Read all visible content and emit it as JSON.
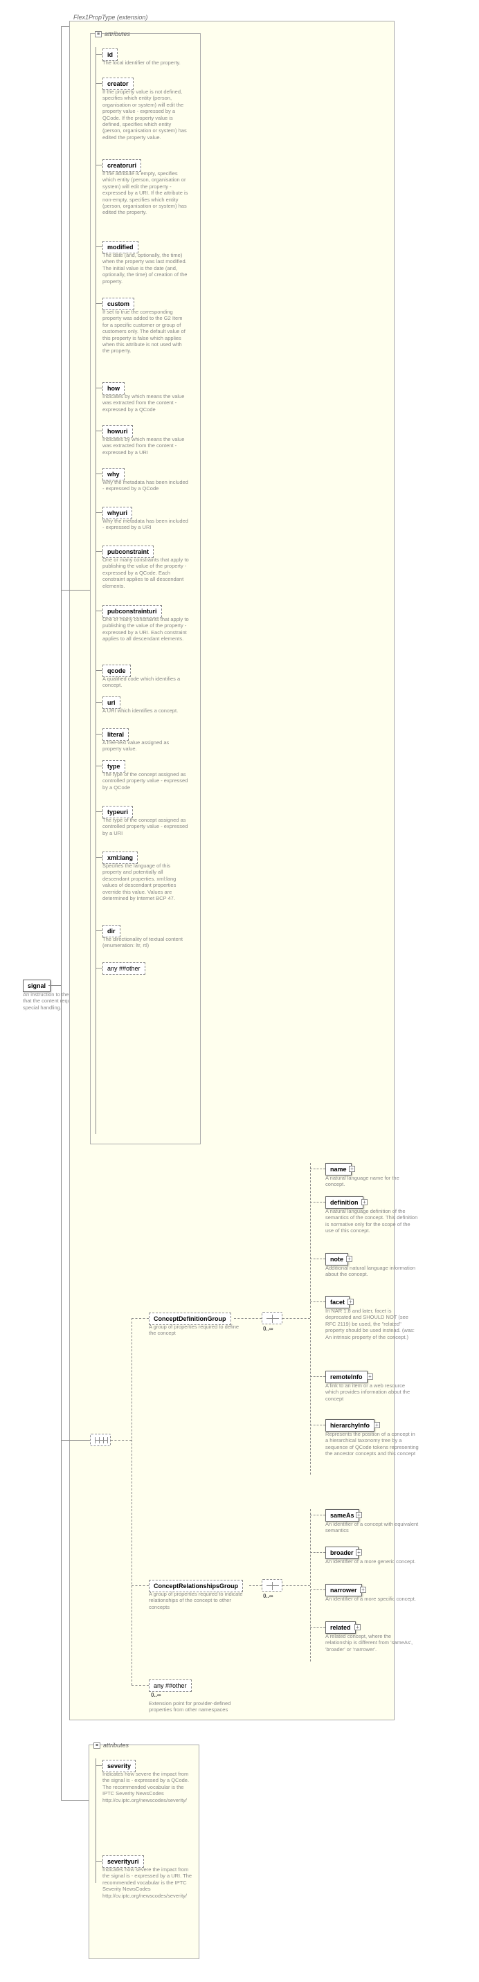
{
  "header": {
    "title": "Flex1PropType (extension)"
  },
  "root": {
    "label": "signal",
    "doc": "An instruction to the processor that the content requires special handling."
  },
  "attrs_main": {
    "label": "attributes",
    "items": [
      {
        "name": "id",
        "doc": "The local identifier of the property."
      },
      {
        "name": "creator",
        "doc": "If the property value is not defined, specifies which entity (person, organisation or system) will edit the property value - expressed by a QCode. If the property value is defined, specifies which entity (person, organisation or system) has edited the property value."
      },
      {
        "name": "creatoruri",
        "doc": "If the attribute is empty, specifies which entity (person, organisation or system) will edit the property - expressed by a URI. If the attribute is non-empty, specifies which entity (person, organisation or system) has edited the property."
      },
      {
        "name": "modified",
        "doc": "The date (and, optionally, the time) when the property was last modified. The initial value is the date (and, optionally, the time) of creation of the property."
      },
      {
        "name": "custom",
        "doc": "If set to true the corresponding property was added to the G2 Item for a specific customer or group of customers only. The default value of this property is false which applies when this attribute is not used with the property."
      },
      {
        "name": "how",
        "doc": "Indicates by which means the value was extracted from the content - expressed by a QCode"
      },
      {
        "name": "howuri",
        "doc": "Indicates by which means the value was extracted from the content - expressed by a URI"
      },
      {
        "name": "why",
        "doc": "Why the metadata has been included - expressed by a QCode"
      },
      {
        "name": "whyuri",
        "doc": "Why the metadata has been included - expressed by a URI"
      },
      {
        "name": "pubconstraint",
        "doc": "One or many constraints that apply to publishing the value of the property - expressed by a QCode. Each constraint applies to all descendant elements."
      },
      {
        "name": "pubconstrainturi",
        "doc": "One or many constraints that apply to publishing the value of the property - expressed by a URI. Each constraint applies to all descendant elements."
      },
      {
        "name": "qcode",
        "doc": "A qualified code which identifies a concept."
      },
      {
        "name": "uri",
        "doc": "A URI which identifies a concept."
      },
      {
        "name": "literal",
        "doc": "A free-text value assigned as property value."
      },
      {
        "name": "type",
        "doc": "The type of the concept assigned as controlled property value - expressed by a QCode"
      },
      {
        "name": "typeuri",
        "doc": "The type of the concept assigned as controlled property value - expressed by a URI"
      },
      {
        "name": "xml:lang",
        "doc": "Specifies the language of this property and potentially all descendant properties. xml:lang values of descendant properties override this value. Values are determined by Internet BCP 47."
      },
      {
        "name": "dir",
        "doc": "The directionality of textual content (enumeration: ltr, rtl)"
      }
    ],
    "any": "any ##other"
  },
  "groups": {
    "def": {
      "label": "ConceptDefinitionGroup",
      "doc": "A group of properties required to define the concept",
      "occur": "0..∞"
    },
    "rel": {
      "label": "ConceptRelationshipsGroup",
      "doc": "A group of properties required to indicate relationships of the concept to other concepts",
      "occur": "0..∞"
    },
    "any": {
      "label": "any ##other",
      "occur": "0..∞",
      "doc": "Extension point for provider-defined properties from other namespaces"
    }
  },
  "def_children": [
    {
      "name": "name",
      "doc": "A natural language name for the concept."
    },
    {
      "name": "definition",
      "doc": "A natural language definition of the semantics of the concept. This definition is normative only for the scope of the use of this concept."
    },
    {
      "name": "note",
      "doc": "Additional natural language information about the concept."
    },
    {
      "name": "facet",
      "doc": "In NAR 1.8 and later, facet is deprecated and SHOULD NOT (see RFC 2119) be used, the \"related\" property should be used instead. (was: An intrinsic property of the concept.)"
    },
    {
      "name": "remoteInfo",
      "doc": "A link to an item or a web resource which provides information about the concept"
    },
    {
      "name": "hierarchyInfo",
      "doc": "Represents the position of a concept in a hierarchical taxonomy tree by a sequence of QCode tokens representing the ancestor concepts and this concept"
    }
  ],
  "rel_children": [
    {
      "name": "sameAs",
      "doc": "An identifier of a concept with equivalent semantics"
    },
    {
      "name": "broader",
      "doc": "An identifier of a more generic concept."
    },
    {
      "name": "narrower",
      "doc": "An identifier of a more specific concept."
    },
    {
      "name": "related",
      "doc": "A related concept, where the relationship is different from 'sameAs', 'broader' or 'narrower'."
    }
  ],
  "attrs_sev": {
    "label": "attributes",
    "items": [
      {
        "name": "severity",
        "doc": "Indicates how severe the impact from the signal is - expressed by a QCode. The recommended vocabular is the IPTC Severity NewsCodes http://cv.iptc.org/newscodes/severity/"
      },
      {
        "name": "severityuri",
        "doc": "Indicates how severe the impact from the signal is - expressed by a URI. The recommended vocabular is the IPTC Severity NewsCodes http://cv.iptc.org/newscodes/severity/"
      }
    ]
  }
}
